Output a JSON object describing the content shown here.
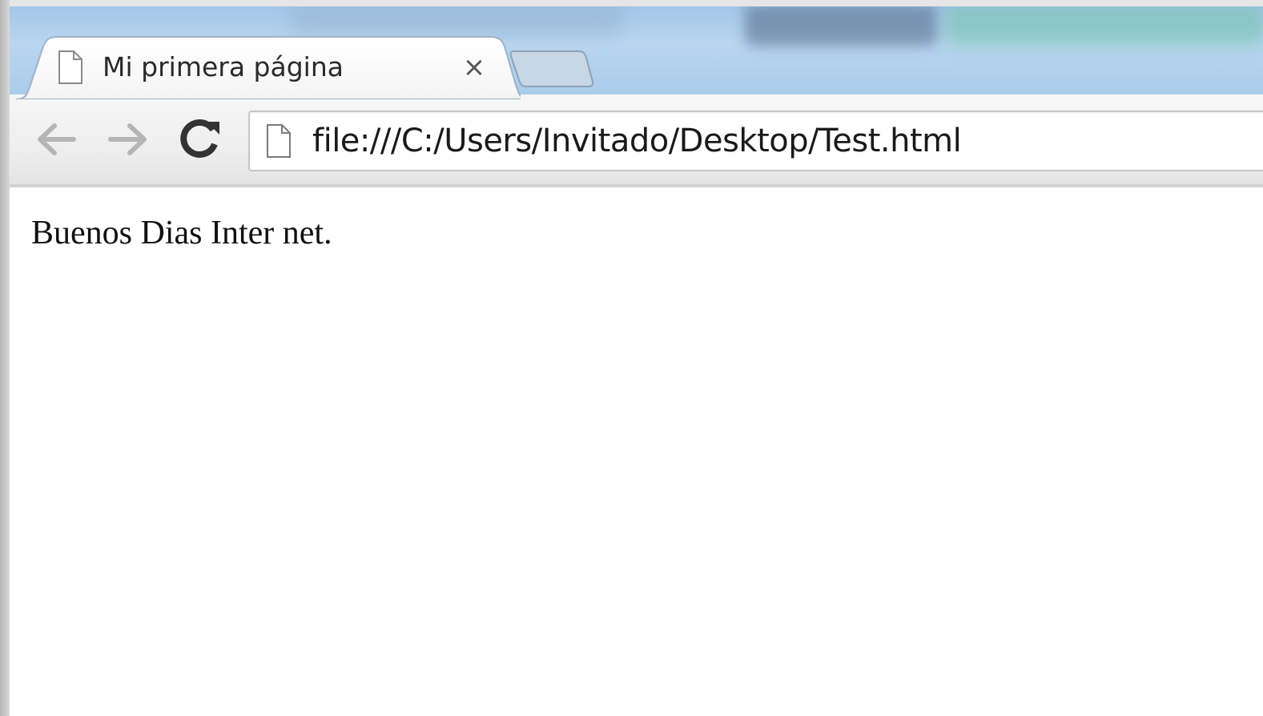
{
  "browser": {
    "tabs": [
      {
        "title": "Mi primera página",
        "active": true,
        "close_glyph": "×",
        "icon": "page-icon"
      }
    ],
    "toolbar": {
      "back_icon": "arrow-left-icon",
      "forward_icon": "arrow-right-icon",
      "reload_icon": "reload-icon",
      "address": "file:///C:/Users/Invitado/Desktop/Test.html",
      "address_icon": "page-icon"
    }
  },
  "page": {
    "text": "Buenos Dias Inter net."
  },
  "colors": {
    "frame": "#b9d6f1",
    "toolbar": "#eeeeee",
    "disabled_arrow": "#b5b5b5",
    "reload": "#333333"
  }
}
